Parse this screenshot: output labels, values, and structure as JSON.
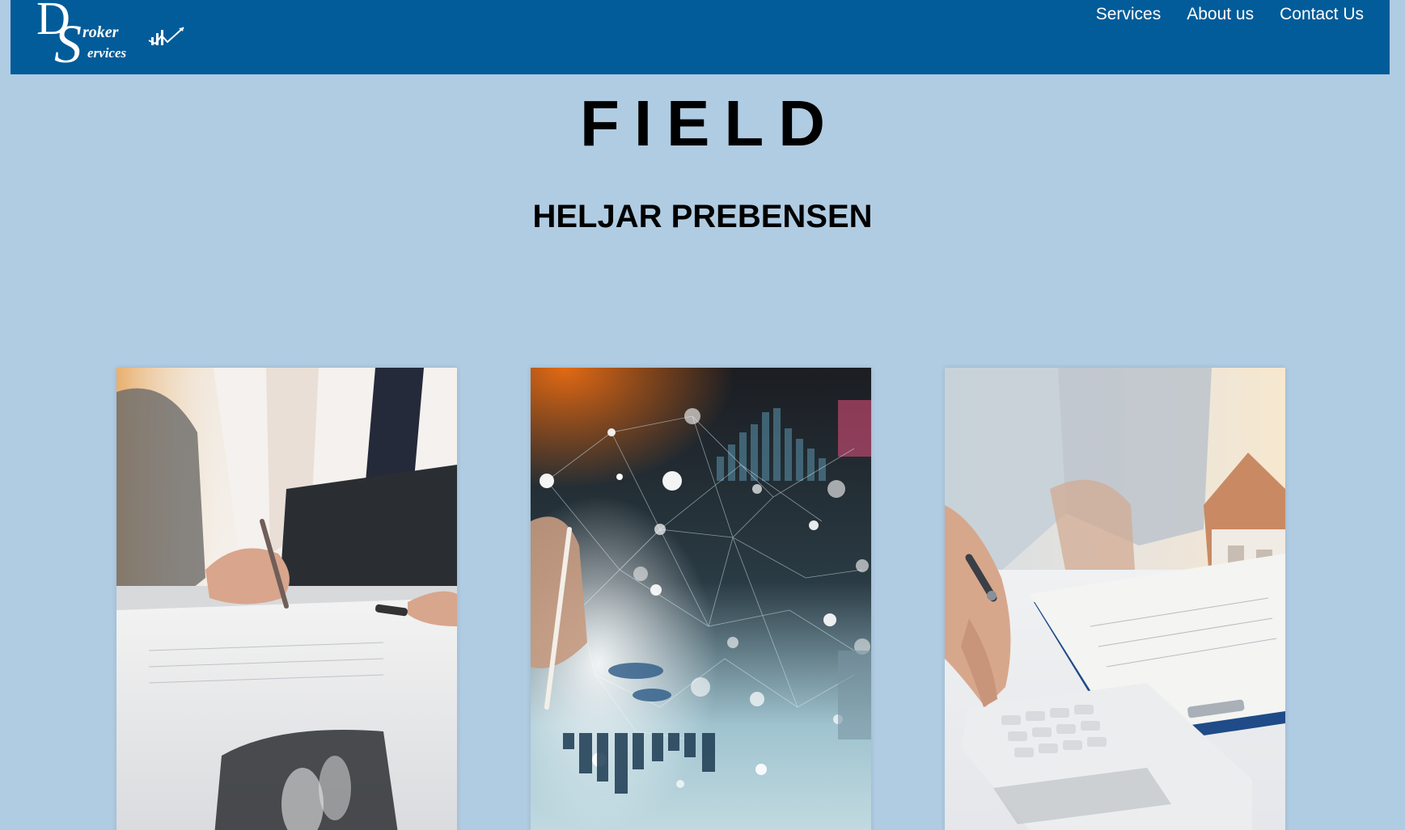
{
  "header": {
    "logo": {
      "letter_d": "D",
      "letter_s": "S",
      "broker": "roker",
      "services": "ervices"
    },
    "nav": [
      {
        "label": "Services"
      },
      {
        "label": "About us"
      },
      {
        "label": "Contact Us"
      }
    ],
    "background_color": "#025c99"
  },
  "hero": {
    "title": "FIELD",
    "subtitle": "HELJAR PREBENSEN"
  },
  "cards": [
    {
      "image": "person-signing-document-photo"
    },
    {
      "image": "business-network-data-chart-photo"
    },
    {
      "image": "calculator-contract-house-model-photo"
    }
  ],
  "colors": {
    "page_background": "#b0cce2",
    "nav_text": "#ffffff",
    "heading_text": "#000000"
  }
}
